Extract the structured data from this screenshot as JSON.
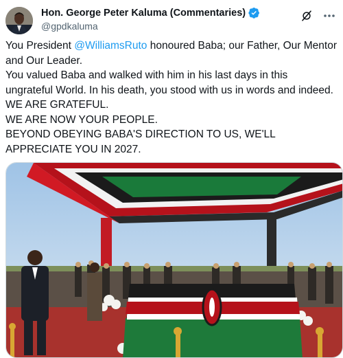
{
  "author": {
    "display_name": "Hon. George Peter Kaluma (Commentaries)",
    "handle": "@gpdkaluma",
    "verified_color": "#1d9bf0"
  },
  "icons": {
    "verified": "verified-badge-icon",
    "grok": "grok-icon",
    "more": "more-dots-icon"
  },
  "tweet": {
    "line1_before": "You President ",
    "mention": "@WilliamsRuto",
    "line1_after": " honoured Baba; our Father, Our Mentor and Our Leader.",
    "line2": "You valued Baba and walked with him in his last days in this ungrateful World. In his death, you stood with us in words and indeed.",
    "line3": "WE ARE GRATEFUL.",
    "line4": "WE ARE NOW YOUR PEOPLE.",
    "line5": "BEYOND OBEYING BABA'S DIRECTION TO US, WE'LL APPRECIATE YOU IN 2027."
  },
  "colors": {
    "mention": "#1d9bf0",
    "text": "#0f1419",
    "muted": "#536471"
  }
}
